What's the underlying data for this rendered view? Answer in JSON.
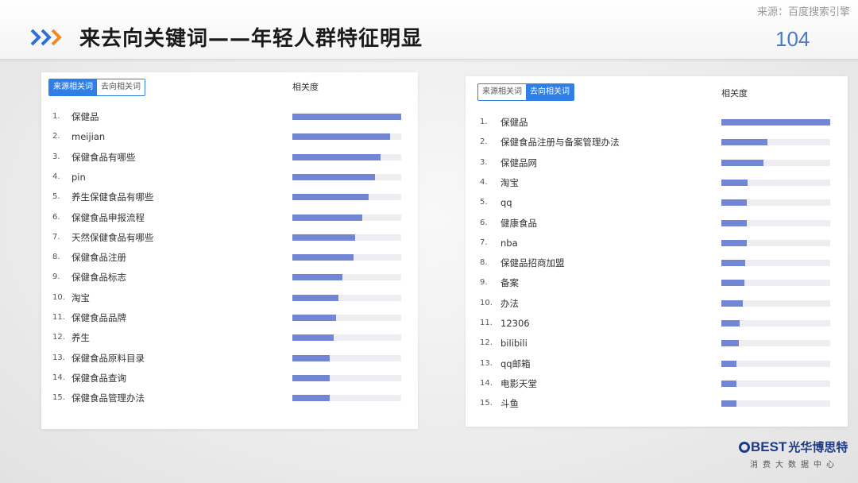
{
  "header": {
    "title": "来去向关键词——年轻人群特征明显",
    "source": "来源：百度搜索引擎",
    "page_number": "104"
  },
  "colors": {
    "bar": "#7386d5",
    "track": "#eeeef2",
    "tab_active": "#2f7fe6",
    "page_number": "#4a7bc8"
  },
  "logo": {
    "brand": "BEST",
    "brand_cn": "光华博思特",
    "subtitle": "消费大数据中心"
  },
  "chart_data": [
    {
      "type": "bar",
      "orientation": "horizontal",
      "tabs": [
        "来源相关词",
        "去向相关词"
      ],
      "active_tab": 0,
      "value_header": "相关度",
      "xlim": [
        0,
        1
      ],
      "ranks": [
        "1.",
        "2.",
        "3.",
        "4.",
        "5.",
        "6.",
        "7.",
        "8.",
        "9.",
        "10.",
        "11.",
        "12.",
        "13.",
        "14.",
        "15."
      ],
      "categories": [
        "保健品",
        "meijian",
        "保健食品有哪些",
        "pin",
        "养生保健食品有哪些",
        "保健食品申报流程",
        "天然保健食品有哪些",
        "保健食品注册",
        "保健食品标志",
        "淘宝",
        "保健食品品牌",
        "养生",
        "保健食品原料目录",
        "保健食品查询",
        "保健食品管理办法"
      ],
      "values": [
        1.0,
        0.9,
        0.81,
        0.76,
        0.7,
        0.64,
        0.58,
        0.56,
        0.46,
        0.42,
        0.4,
        0.38,
        0.34,
        0.34,
        0.34
      ]
    },
    {
      "type": "bar",
      "orientation": "horizontal",
      "tabs": [
        "来源相关词",
        "去向相关词"
      ],
      "active_tab": 1,
      "value_header": "相关度",
      "xlim": [
        0,
        1
      ],
      "ranks": [
        "1.",
        "2.",
        "3.",
        "4.",
        "5.",
        "6.",
        "7.",
        "8.",
        "9.",
        "10.",
        "11.",
        "12.",
        "13.",
        "14.",
        "15."
      ],
      "categories": [
        "保健品",
        "保健食品注册与备案管理办法",
        "保健品网",
        "淘宝",
        "qq",
        "健康食品",
        "nba",
        "保健品招商加盟",
        "备案",
        "办法",
        "12306",
        "bilibili",
        "qq邮箱",
        "电影天堂",
        "斗鱼"
      ],
      "values": [
        1.0,
        0.42,
        0.39,
        0.24,
        0.23,
        0.23,
        0.23,
        0.22,
        0.21,
        0.2,
        0.17,
        0.16,
        0.14,
        0.14,
        0.14
      ]
    }
  ]
}
